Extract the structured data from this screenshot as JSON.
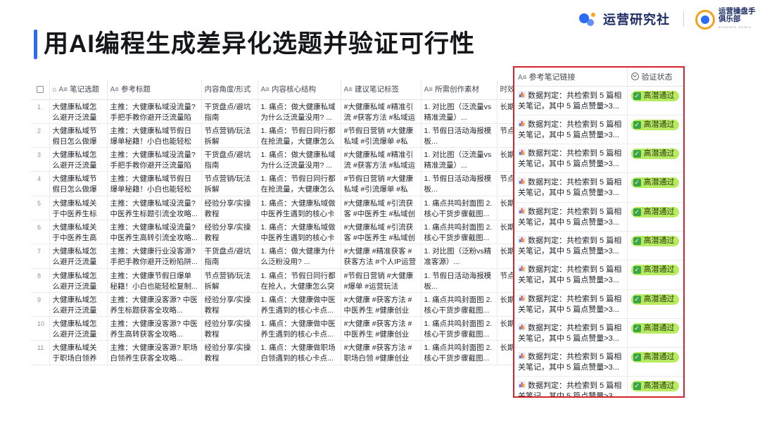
{
  "slide": {
    "title": "用AI编程生成差异化选题并验证可行性"
  },
  "logos": {
    "brand": "运营研究社",
    "club_line1": "运营操盘手",
    "club_line2": "俱乐部",
    "club_sub": "ADVANCE GOALS"
  },
  "colors": {
    "accent": "#2d6bf0",
    "highlight_border": "#d3252b",
    "badge_bg": "#b7eb62",
    "badge_check": "#3aa544"
  },
  "table": {
    "headers": {
      "topic": "笔记选题",
      "ref_title": "参考标题",
      "angle": "内容角度/形式",
      "structure": "内容核心结构",
      "tags": "建议笔记标签",
      "material": "所需创作素材",
      "timing": "时效"
    },
    "rows": [
      {
        "num": "1",
        "topic": "大健康私域怎么避开泛流量精...",
        "ref_title": "主推：大健康私域没流量?手把手教你避开泛流量陷阱...",
        "angle": "干货盘点/避坑指南",
        "structure": "1. 痛点：做大健康私域为什么泛流量没用? ...",
        "tags": "#大健康私域 #精准引流 #获客方法 #私域运营",
        "material": "1. 对比图（泛流量vs精准流量）...",
        "timing": "长期"
      },
      {
        "num": "2",
        "topic": "大健康私域节假日怎么做爆单...",
        "ref_title": "主推：大健康私域节假日爆单秘籍！小白也能轻松复制...",
        "angle": "节点营销/玩法拆解",
        "structure": "1. 痛点：节假日同行都在抢流量，大健康怎么突...",
        "tags": "#节假日营销 #大健康私域 #引流爆单 #私域...",
        "material": "1. 节假日活动海报模板...",
        "timing": "节点"
      },
      {
        "num": "3",
        "topic": "大健康私域怎么避开泛流量精...",
        "ref_title": "主推：大健康私域没流量?手把手教你避开泛流量陷阱...",
        "angle": "干货盘点/避坑指南",
        "structure": "1. 痛点：做大健康私域为什么泛流量没用? ...",
        "tags": "#大健康私域 #精准引流 #获客方法 #私域运营",
        "material": "1. 对比图（泛流量vs精准流量）...",
        "timing": "长期"
      },
      {
        "num": "4",
        "topic": "大健康私域节假日怎么做爆单...",
        "ref_title": "主推：大健康私域节假日爆单秘籍！小白也能轻松复制...",
        "angle": "节点营销/玩法拆解",
        "structure": "1. 痛点：节假日同行都在抢流量，大健康怎么突...",
        "tags": "#节假日营销 #大健康私域 #引流爆单 #私域...",
        "material": "1. 节假日活动海报模板...",
        "timing": "节点"
      },
      {
        "num": "5",
        "topic": "大健康私域关于中医养生标题...",
        "ref_title": "主推：大健康私域没流量?中医养生标题引流全攻略...",
        "angle": "经验分享/实操教程",
        "structure": "1. 痛点：大健康私域做中医养生遇到的核心卡点...",
        "tags": "#大健康私域 #引流获客 #中医养生 #私域创业",
        "material": "1. 痛点共鸣封面图 2. 核心干货步骤截图...",
        "timing": "长期"
      },
      {
        "num": "6",
        "topic": "大健康私域关于中医养生高转...",
        "ref_title": "主推：大健康私域没流量?中医养生高转引流全攻略...",
        "angle": "经验分享/实操教程",
        "structure": "1. 痛点：大健康私域做中医养生遇到的核心卡点...",
        "tags": "#大健康私域 #引流获客 #中医养生 #私域创业",
        "material": "1. 痛点共鸣封面图 2. 核心干货步骤截图...",
        "timing": "长期"
      },
      {
        "num": "7",
        "topic": "大健康私域怎么避开泛流量精...",
        "ref_title": "主推：大健康行业没客源?手把手教你避开泛粉陷阱...",
        "angle": "干货盘点/避坑指南",
        "structure": "1. 痛点：做大健康为什么泛粉没用? ...",
        "tags": "#大健康 #精准获客 #获客方法 #个人IP运营",
        "material": "1. 对比图（泛粉vs精准客源）...",
        "timing": "长期"
      },
      {
        "num": "8",
        "topic": "大健康私域怎么避开泛流量精...",
        "ref_title": "主推：大健康节假日爆单秘籍！小白也能轻松复制...",
        "angle": "节点营销/玩法拆解",
        "structure": "1. 痛点：节假日同行都在抢人，大健康怎么突破...",
        "tags": "#节假日营销 #大健康 #爆单 #运营玩法",
        "material": "1. 节假日活动海报模板...",
        "timing": "节点"
      },
      {
        "num": "9",
        "topic": "大健康私域怎么避开泛流量精...",
        "ref_title": "主推：大健康没客源? 中医养生标题获客全攻略...",
        "angle": "经验分享/实操教程",
        "structure": "1. 痛点：大健康做中医养生遇到的核心卡点...",
        "tags": "#大健康 #获客方法 #中医养生 #健康创业",
        "material": "1. 痛点共鸣封面图 2. 核心干货步骤截图...",
        "timing": "长期"
      },
      {
        "num": "10",
        "topic": "大健康私域怎么避开泛流量精...",
        "ref_title": "主推：大健康没客源? 中医养生高转获客全攻略...",
        "angle": "经验分享/实操教程",
        "structure": "1. 痛点：大健康做中医养生遇到的核心卡点...",
        "tags": "#大健康 #获客方法 #中医养生 #健康创业",
        "material": "1. 痛点共鸣封面图 2. 核心干货步骤截图...",
        "timing": "长期"
      },
      {
        "num": "11",
        "topic": "大健康私域关于职场白领养生...",
        "ref_title": "主推：大健康没客源? 职场白领养生获客全攻略...",
        "angle": "经验分享/实操教程",
        "structure": "1. 痛点：大健康做职场白领遇到的核心卡点...",
        "tags": "#大健康 #获客方法 #职场白领 #健康创业",
        "material": "1. 痛点共鸣封面图 2. 核心干货步骤截图...",
        "timing": "长期"
      }
    ]
  },
  "panel": {
    "headers": {
      "ref_link": "参考笔记链接",
      "status": "验证状态"
    },
    "cell_text": "数据判定：共检索到 5 篇相关笔记，其中 5 篇点赞量>3...",
    "badge_text": "高潜通过",
    "row_count": 11
  }
}
